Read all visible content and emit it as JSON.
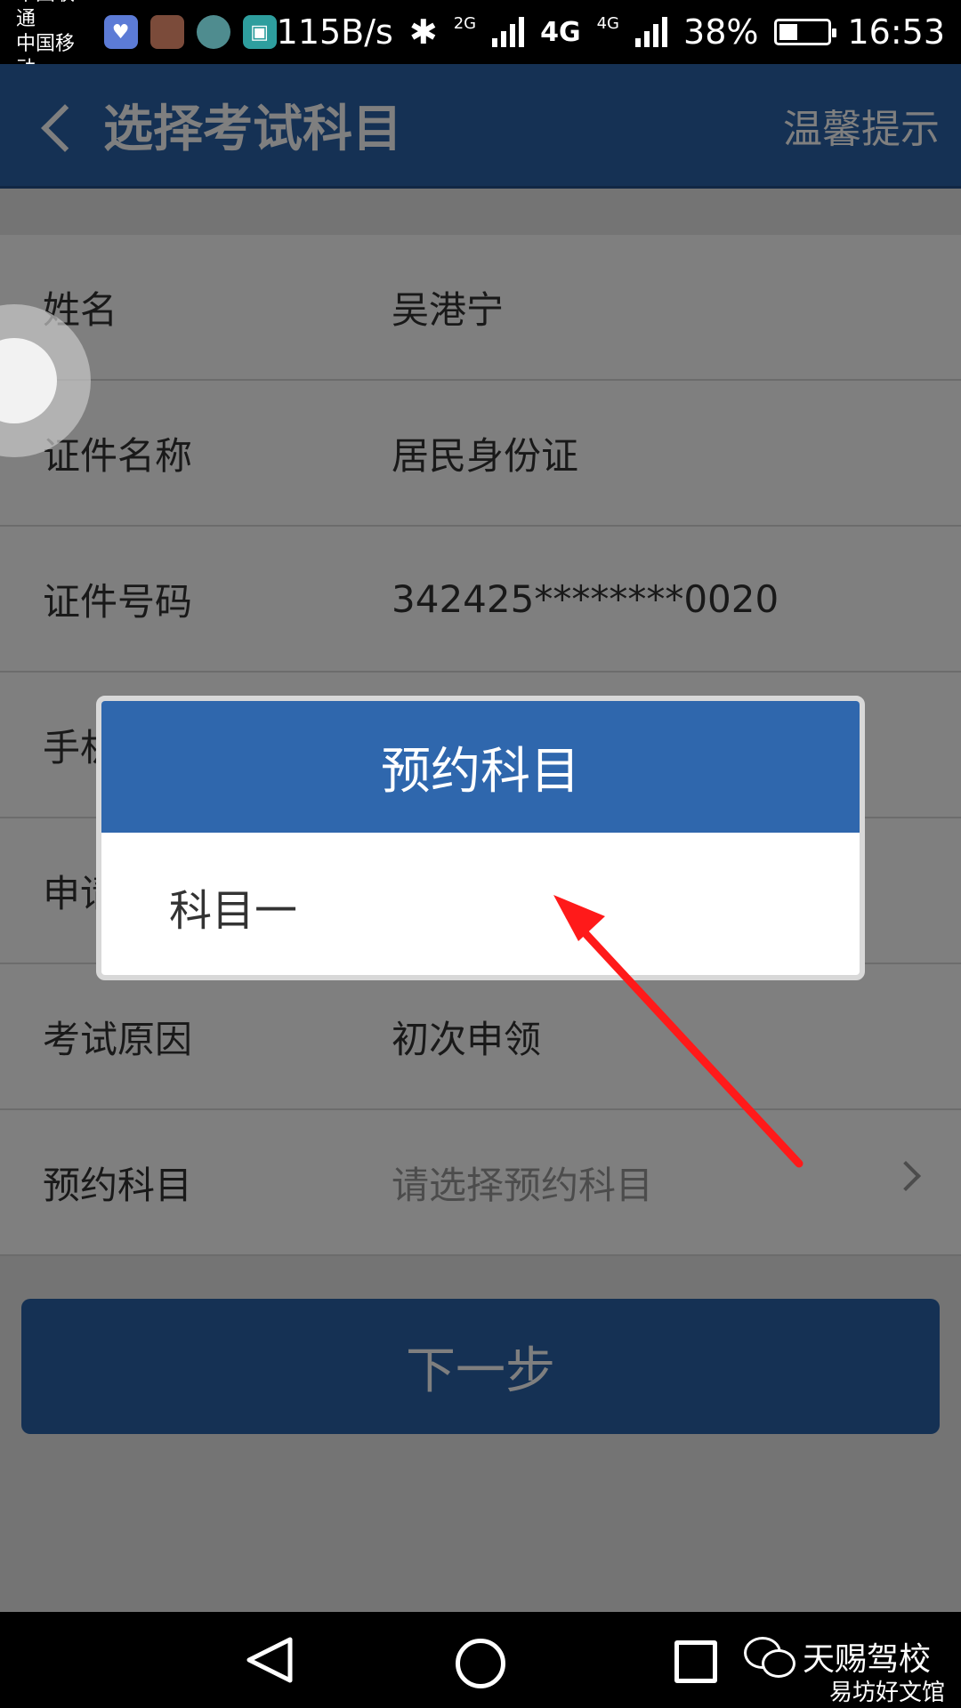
{
  "status_bar": {
    "carrier1": "中国联通",
    "carrier2": "中国移动",
    "net_speed": "115B/s",
    "net_2g": "2G",
    "net_4g_a": "4G",
    "net_4g_b": "4G",
    "battery": "38%",
    "battery_level": 0.38,
    "time": "16:53",
    "icons": [
      "health-app-icon",
      "contact-avatar-icon",
      "app-avatar-icon",
      "gallery-app-icon",
      "bluetooth-icon",
      "signal-icon",
      "battery-icon"
    ]
  },
  "header": {
    "title": "选择考试科目",
    "tip": "温馨提示"
  },
  "form": {
    "rows": [
      {
        "label": "姓名",
        "value": "吴港宁"
      },
      {
        "label": "证件名称",
        "value": "居民身份证"
      },
      {
        "label": "证件号码",
        "value": "342425********0020"
      },
      {
        "label": "手机",
        "value": ""
      },
      {
        "label": "申请",
        "value": ""
      },
      {
        "label": "考试原因",
        "value": "初次申领"
      },
      {
        "label": "预约科目",
        "value": "请选择预约科目"
      }
    ],
    "next_button": "下一步"
  },
  "dialog": {
    "title": "预约科目",
    "options": [
      "科目一"
    ]
  },
  "watermark": {
    "name": "天赐驾校",
    "sub": "易坊好文馆"
  },
  "colors": {
    "primary": "#2b63a8",
    "arrow": "#ff0000"
  }
}
